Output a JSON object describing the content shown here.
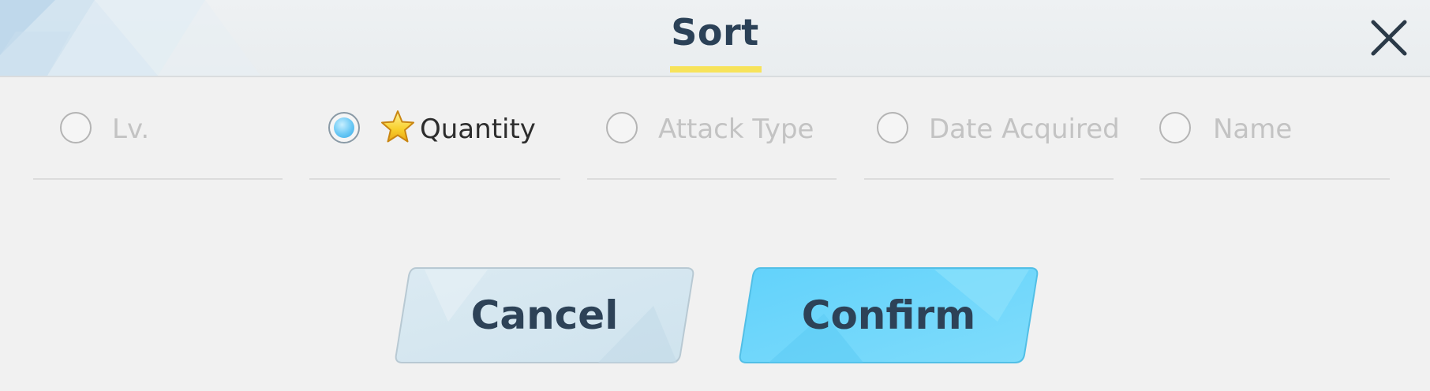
{
  "dialog": {
    "title": "Sort",
    "close_icon": "close-icon",
    "accent_color": "#f7e35a"
  },
  "sort_options": [
    {
      "label": "Lv.",
      "selected": false
    },
    {
      "label": "Quantity",
      "selected": true,
      "icon": "star-icon"
    },
    {
      "label": "Attack Type",
      "selected": false
    },
    {
      "label": "Date Acquired",
      "selected": false
    },
    {
      "label": "Name",
      "selected": false
    }
  ],
  "buttons": {
    "cancel_label": "Cancel",
    "confirm_label": "Confirm",
    "cancel_color": "#d6e8f0",
    "confirm_color": "#6fd6fb"
  }
}
